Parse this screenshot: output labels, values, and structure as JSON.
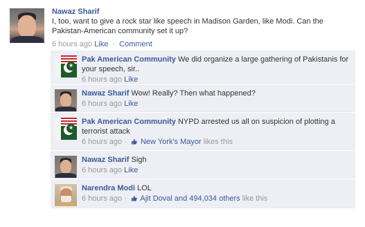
{
  "post": {
    "author": "Nawaz Sharif",
    "text": "I, too, want to give a rock star like speech in Madison Garden, like Modi. Can the Pakistan-American community set it up?",
    "time": "6 hours ago",
    "like_label": "Like",
    "separator": "·",
    "comment_label": "Comment"
  },
  "comments": [
    {
      "author": "Pak American Community",
      "text": "We did organize a large gathering of Pakistanis for your speech, sir..",
      "time": "6 hours ago",
      "like_label": "Like",
      "avatar": "pak-american-flag"
    },
    {
      "author": "Nawaz Sharif",
      "text": "Wow! Really? Then what happened?",
      "time": "6 hours ago",
      "like_label": "Like",
      "avatar": "nawaz-sharif-photo"
    },
    {
      "author": "Pak American Community",
      "text": "NYPD arrested us all on suspicion of plotting a terrorist attack",
      "time": "6 hours ago",
      "likers": "New York's Mayor",
      "likes_suffix": "likes this",
      "avatar": "pak-american-flag"
    },
    {
      "author": "Nawaz Sharif",
      "text": "Sigh",
      "time": "6 hours ago",
      "like_label": "Like",
      "avatar": "nawaz-sharif-photo"
    },
    {
      "author": "Narendra Modi",
      "text": "LOL",
      "time": "6 hours ago",
      "likers": "Ajit Doval and 494,034 others",
      "likes_suffix": "like this",
      "avatar": "narendra-modi-photo"
    }
  ],
  "meta_separator": "·",
  "thumb_icon": "thumbs-up-icon",
  "colors": {
    "link": "#3b5998",
    "comment_bg": "#edeff4",
    "meta": "#999999",
    "text": "#333333"
  }
}
